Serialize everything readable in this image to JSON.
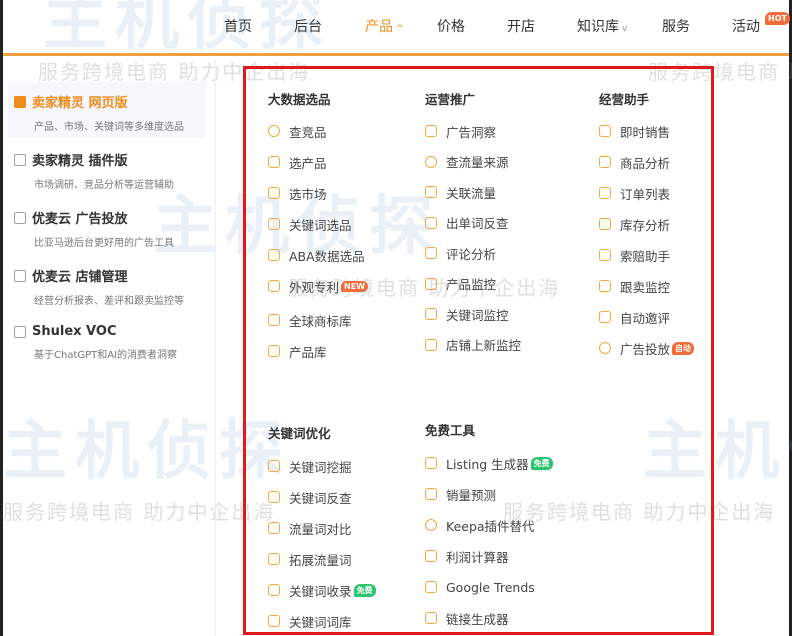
{
  "watermark": {
    "logo": "主机侦探",
    "slogan": "服务跨境电商 助力中企出海"
  },
  "nav": {
    "items": [
      {
        "label": "首页"
      },
      {
        "label": "后台"
      },
      {
        "label": "产品",
        "caret": "^",
        "active": true
      },
      {
        "label": "价格"
      },
      {
        "label": "开店"
      },
      {
        "label": "知识库",
        "caret": "v"
      },
      {
        "label": "服务"
      },
      {
        "label": "活动",
        "badge": "HOT"
      }
    ]
  },
  "left": {
    "items": [
      {
        "title": "卖家精灵 网页版",
        "sub": "产品、市场、关键词等多维度选品",
        "selected": true
      },
      {
        "title": "卖家精灵 插件版",
        "sub": "市场调研、竞品分析等运营辅助"
      },
      {
        "title": "优麦云 广告投放",
        "sub": "比亚马逊后台更好用的广告工具"
      },
      {
        "title": "优麦云 店铺管理",
        "sub": "经营分析报表、差评和跟卖监控等"
      },
      {
        "title": "Shulex VOC",
        "sub": "基于ChatGPT和AI的消费者洞察"
      }
    ]
  },
  "columns": [
    {
      "title": "大数据选品",
      "items": [
        {
          "label": "查竞品",
          "icon": "search-icon"
        },
        {
          "label": "选产品",
          "icon": "filter-icon"
        },
        {
          "label": "选市场",
          "icon": "market-icon"
        },
        {
          "label": "关键词选品",
          "icon": "grid-icon"
        },
        {
          "label": "ABA数据选品",
          "icon": "monitor-icon"
        },
        {
          "label": "外观专利",
          "icon": "patent-icon",
          "badge": "NEW",
          "badge_color": "#f26b3a"
        },
        {
          "label": "全球商标库",
          "icon": "trademark-icon"
        },
        {
          "label": "产品库",
          "icon": "box-icon"
        }
      ]
    },
    {
      "title": "运营推广",
      "items": [
        {
          "label": "广告洞察",
          "icon": "ad-icon"
        },
        {
          "label": "查流量来源",
          "icon": "traffic-icon"
        },
        {
          "label": "关联流量",
          "icon": "link-traffic-icon"
        },
        {
          "label": "出单词反查",
          "icon": "reverse-icon"
        },
        {
          "label": "评论分析",
          "icon": "comment-icon"
        },
        {
          "label": "产品监控",
          "icon": "product-monitor-icon"
        },
        {
          "label": "关键词监控",
          "icon": "keyword-monitor-icon"
        },
        {
          "label": "店铺上新监控",
          "icon": "store-monitor-icon"
        }
      ]
    },
    {
      "title": "经营助手",
      "items": [
        {
          "label": "即时销售",
          "icon": "sales-icon"
        },
        {
          "label": "商品分析",
          "icon": "analysis-icon"
        },
        {
          "label": "订单列表",
          "icon": "order-icon"
        },
        {
          "label": "库存分析",
          "icon": "inventory-icon"
        },
        {
          "label": "索赔助手",
          "icon": "claim-icon"
        },
        {
          "label": "跟卖监控",
          "icon": "follow-icon"
        },
        {
          "label": "自动邀评",
          "icon": "review-icon"
        },
        {
          "label": "广告投放",
          "icon": "pie-icon",
          "badge": "自动",
          "badge_color": "#f26b3a"
        }
      ]
    },
    {
      "title": "关键词优化",
      "items": [
        {
          "label": "关键词挖掘",
          "icon": "database-icon"
        },
        {
          "label": "关键词反查",
          "icon": "reverse-keyword-icon"
        },
        {
          "label": "流量词对比",
          "icon": "compare-icon"
        },
        {
          "label": "拓展流量词",
          "icon": "expand-icon"
        },
        {
          "label": "关键词收录",
          "icon": "chart-icon",
          "badge": "免费",
          "badge_color": "#2cc46e"
        },
        {
          "label": "关键词词库",
          "icon": "library-icon"
        }
      ]
    },
    {
      "title": "免费工具",
      "items": [
        {
          "label": "Listing 生成器",
          "icon": "list-icon",
          "badge": "免费",
          "badge_color": "#2cc46e"
        },
        {
          "label": "销量预测",
          "icon": "forecast-icon"
        },
        {
          "label": "Keepa插件替代",
          "icon": "keepa-icon"
        },
        {
          "label": "利润计算器",
          "icon": "calculator-icon"
        },
        {
          "label": "Google Trends",
          "icon": "google-icon"
        },
        {
          "label": "链接生成器",
          "icon": "chain-icon"
        }
      ]
    }
  ]
}
